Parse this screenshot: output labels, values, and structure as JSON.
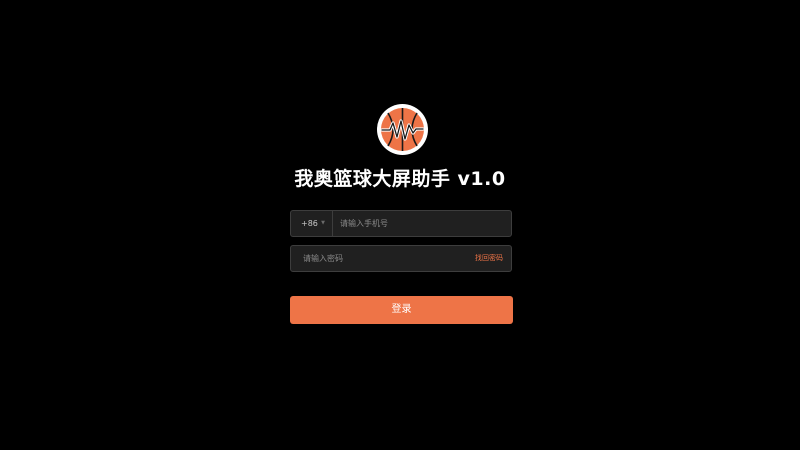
{
  "app": {
    "title": "我奥篮球大屏助手 v1.0",
    "logo_icon": "basketball-logo-icon"
  },
  "form": {
    "country_code": "+86",
    "country_caret": "▼",
    "phone_placeholder": "请输入手机号",
    "password_placeholder": "请输入密码",
    "forgot_password_label": "找回密码",
    "login_label": "登录"
  },
  "colors": {
    "background": "#000000",
    "accent": "#EE7447",
    "field_background": "#202020",
    "field_border": "#3D3D3D",
    "title_text": "#FFFFFF"
  }
}
